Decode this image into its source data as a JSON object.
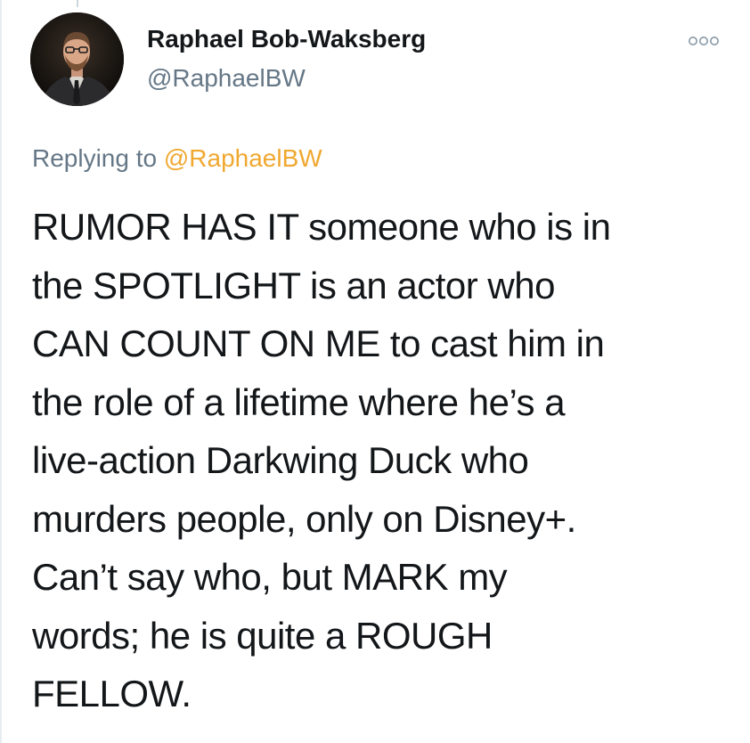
{
  "author": {
    "name": "Raphael Bob-Waksberg",
    "handle": "@RaphaelBW",
    "avatar_icon": "profile-photo"
  },
  "menu": {
    "icon": "more-options-icon"
  },
  "reply": {
    "prefix": "Replying to ",
    "target": "@RaphaelBW"
  },
  "tweet": {
    "text": "RUMOR HAS IT someone who is in\nthe SPOTLIGHT is an actor who\nCAN COUNT ON ME to cast him in\nthe role of a lifetime where he’s a\nlive-action Darkwing Duck who\nmurders people, only on Disney+.\nCan’t say who, but MARK my\nwords; he is quite a ROUGH\nFELLOW."
  },
  "colors": {
    "text": "#14171a",
    "muted": "#657786",
    "link": "#f0a830",
    "background": "#ffffff"
  }
}
